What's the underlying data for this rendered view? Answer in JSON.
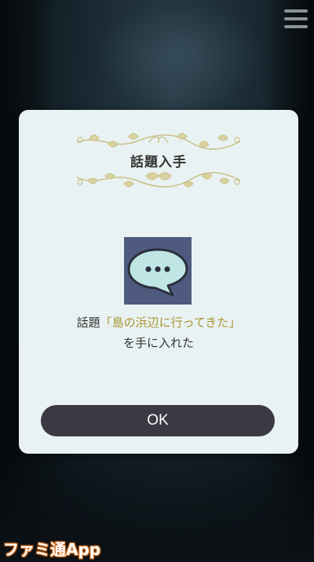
{
  "menu": {
    "icon": "hamburger-menu-icon"
  },
  "dialog": {
    "title": "話題入手",
    "topic_icon": "speech-bubble-icon",
    "message_prefix": "話題",
    "topic_open": "「",
    "topic_name": "島の浜辺に行ってきた",
    "topic_close": "」",
    "message_suffix": "を手に入れた",
    "ok_label": "OK"
  },
  "watermark": {
    "text": "ファミ通App"
  },
  "colors": {
    "dialog_bg": "#e9f2f2",
    "button_bg": "#3b3a44",
    "topic_highlight": "#a8942c",
    "icon_bg": "#4e5b7f",
    "ornament": "#c8c088"
  }
}
